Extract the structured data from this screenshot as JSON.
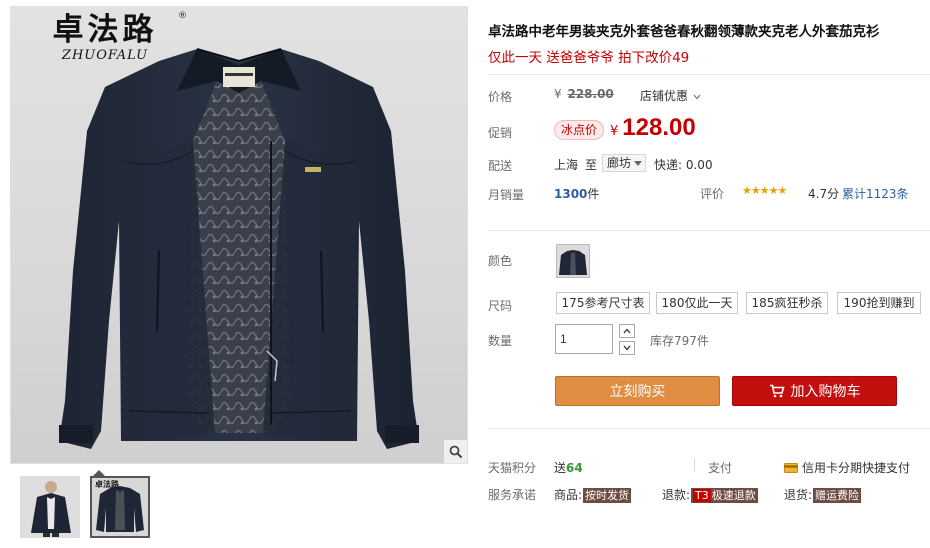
{
  "gallery": {
    "brand_cn": "卓法路",
    "brand_en": "ZHUOFALU",
    "brand_reg": "®",
    "thumbnails": [
      {
        "logo": ""
      },
      {
        "logo": "卓法路"
      }
    ]
  },
  "product": {
    "title": "卓法路中老年男装夹克外套爸爸春秋翻领薄款夹克老人外套茄克衫",
    "subtitle": "仅此一天 送爸爸爷爷 拍下改价49"
  },
  "price": {
    "label": "价格",
    "currency": "¥",
    "original": "228.00",
    "shop_discount": "店铺优惠"
  },
  "promo": {
    "label": "促销",
    "badge": "冰点价",
    "currency": "¥",
    "price": "128.00"
  },
  "shipping": {
    "label": "配送",
    "from": "上海",
    "to_word": "至",
    "destination": "廊坊",
    "fee": "快递: 0.00"
  },
  "sales": {
    "label": "月销量",
    "count": "1300",
    "unit": "件",
    "rating_label": "评价",
    "stars": "★★★★★",
    "score": "4.7分",
    "reviews": "累计1123条"
  },
  "color": {
    "label": "颜色"
  },
  "size": {
    "label": "尺码",
    "options": [
      "175参考尺寸表",
      "180仅此一天",
      "185疯狂秒杀",
      "190抢到赚到"
    ]
  },
  "quantity": {
    "label": "数量",
    "value": "1",
    "stock": "库存797件"
  },
  "actions": {
    "buy_now": "立刻购买",
    "add_to_cart": "加入购物车"
  },
  "tmall": {
    "points_label": "天猫积分",
    "points_prefix": "送",
    "points": "64",
    "pay_label": "支付",
    "credit_card": "信用卡分期",
    "quick_pay": "快捷支付"
  },
  "service": {
    "label": "服务承诺",
    "item1_label": "商品:",
    "item1_tag": "按时发货",
    "item2_label": "退款:",
    "item2_hl": "T3",
    "item2_tag": "极速退款",
    "item3_label": "退货:",
    "item3_tag": "赠运费险"
  },
  "colors": {
    "accent_red": "#c40000",
    "buy_orange": "#de8d43",
    "cart_red": "#c40f0f",
    "link_blue": "#2a5fa4",
    "star_gold": "#e5a300"
  }
}
